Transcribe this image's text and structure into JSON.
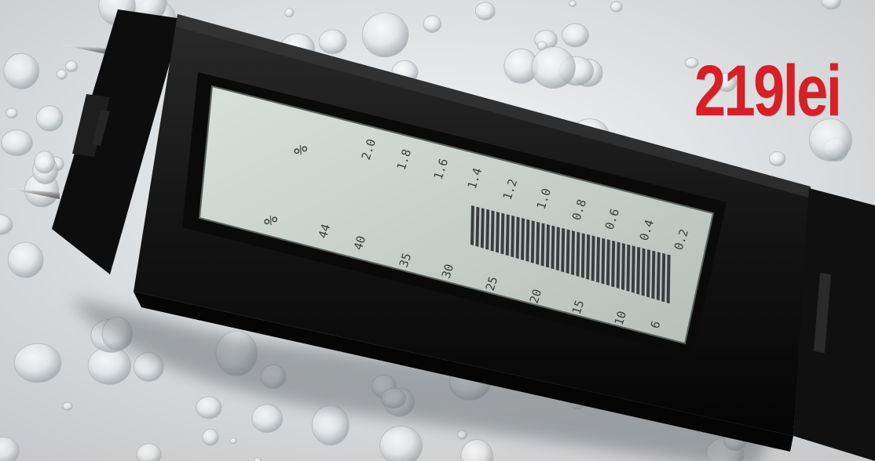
{
  "price_text": "219lei",
  "colors": {
    "price": "#d81e26",
    "device_body": "#141414",
    "lcd_background": "#c9d0cc",
    "lcd_segments": "#3a3e40"
  },
  "icons": [
    "water-droplets-background",
    "moisture-meter-device",
    "metal-probe-pins"
  ],
  "lcd": {
    "top_scale_unit": "%",
    "top_scale_labels": [
      "2.0",
      "1.8",
      "1.6",
      "1.4",
      "1.2",
      "1.0",
      "0.8",
      "0.6",
      "0.4",
      "0.2"
    ],
    "bottom_scale_unit": "%",
    "bottom_scale_labels": [
      "44",
      "40",
      "35",
      "30",
      "25",
      "20",
      "15",
      "10",
      "6"
    ]
  }
}
